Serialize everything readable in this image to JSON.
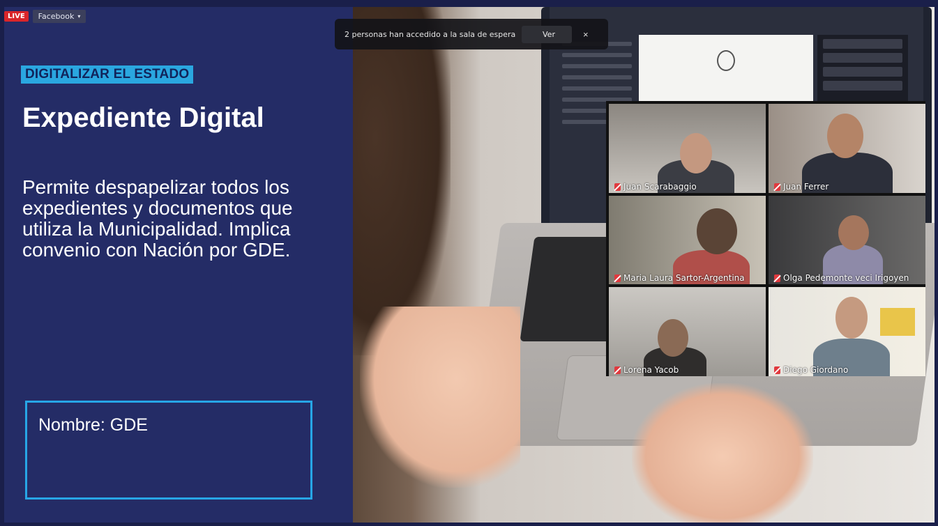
{
  "stream": {
    "live_badge": "LIVE",
    "platform": "Facebook",
    "caret": "▾"
  },
  "slide": {
    "category": "DIGITALIZAR EL ESTADO",
    "title": "Expediente Digital",
    "description": "Permite despapelizar todos los expedientes y documentos que utiliza la Municipalidad. Implica convenio con Nación por GDE.",
    "name_label": "Nombre: GDE"
  },
  "notification": {
    "text": "2 personas han accedido a la sala de espera",
    "button": "Ver",
    "close": "×"
  },
  "participants": [
    {
      "name": "Juan Scarabaggio"
    },
    {
      "name": "Juan Ferrer"
    },
    {
      "name": "Maria Laura Sartor-Argentina"
    },
    {
      "name": "Olga Pedemonte   veci Irigoyen"
    },
    {
      "name": "Lorena Yacob"
    },
    {
      "name": "Diego Giordano"
    }
  ],
  "colors": {
    "slide_bg": "#242c66",
    "accent": "#27a6e6",
    "live": "#d9252a",
    "mic_muted": "#e0393e"
  }
}
